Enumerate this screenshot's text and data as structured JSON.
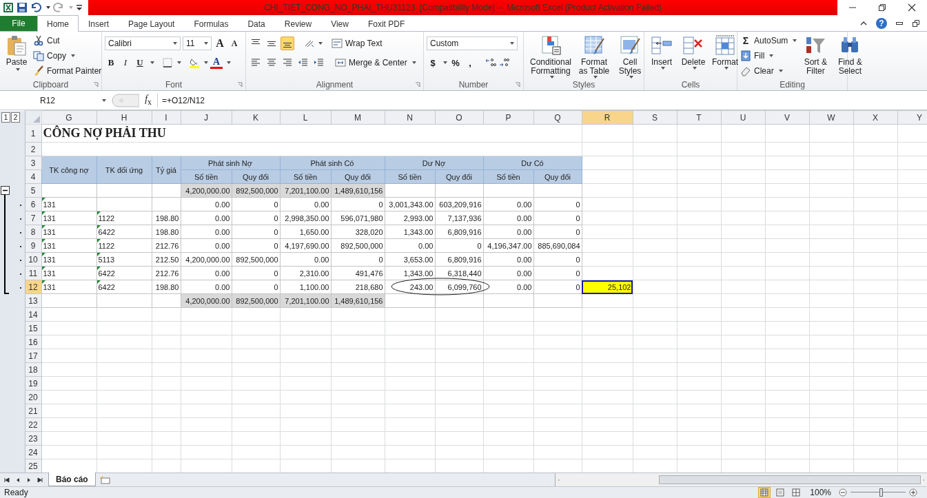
{
  "title_bar": {
    "title": "CHI_TIET_CONG_NO_PHAI_THU31123  [Compatibility Mode]  -  Microsoft Excel (Product Activation Failed)"
  },
  "ribbon": {
    "tabs": [
      {
        "label": "File",
        "kind": "file",
        "selected": false
      },
      {
        "label": "Home",
        "kind": "tab",
        "selected": true
      },
      {
        "label": "Insert",
        "kind": "tab",
        "selected": false
      },
      {
        "label": "Page Layout",
        "kind": "tab",
        "selected": false
      },
      {
        "label": "Formulas",
        "kind": "tab",
        "selected": false
      },
      {
        "label": "Data",
        "kind": "tab",
        "selected": false
      },
      {
        "label": "Review",
        "kind": "tab",
        "selected": false
      },
      {
        "label": "View",
        "kind": "tab",
        "selected": false
      },
      {
        "label": "Foxit PDF",
        "kind": "tab",
        "selected": false
      }
    ],
    "help": "?",
    "clipboard": {
      "label": "Clipboard",
      "paste": "Paste",
      "cut": "Cut",
      "copy": "Copy",
      "format_painter": "Format Painter"
    },
    "font": {
      "label": "Font",
      "family": "Calibri",
      "size": "11",
      "grow": "A",
      "shrink": "A",
      "bold": "B",
      "italic": "I",
      "underline": "U",
      "font_color_letter": "A"
    },
    "alignment": {
      "label": "Alignment",
      "vertical": [
        {
          "kind": "top",
          "selected": false
        },
        {
          "kind": "middle",
          "selected": false
        },
        {
          "kind": "bottom",
          "selected": true
        }
      ],
      "wrap": "Wrap Text",
      "merge": "Merge & Center"
    },
    "number": {
      "label": "Number",
      "format": "Custom",
      "currency": "$",
      "percent": "%",
      "comma": ","
    },
    "styles": {
      "label": "Styles",
      "buttons": [
        {
          "label": "Conditional Formatting",
          "kind": "conditional"
        },
        {
          "label": "Format as Table",
          "kind": "table"
        },
        {
          "label": "Cell Styles",
          "kind": "cellstyles"
        }
      ]
    },
    "cells": {
      "label": "Cells",
      "buttons": [
        {
          "label": "Insert",
          "kind": "insert"
        },
        {
          "label": "Delete",
          "kind": "delete"
        },
        {
          "label": "Format",
          "kind": "format"
        }
      ]
    },
    "editing": {
      "label": "Editing",
      "sigma": "Σ",
      "autosum": "AutoSum",
      "fill": "Fill",
      "clear": "Clear",
      "sort": "Sort & Filter",
      "find": "Find & Select"
    }
  },
  "formula_bar": {
    "name_box": "R12",
    "function_label": "*f*$_{x}$",
    "formula": "=+O12/N12"
  },
  "sheet": {
    "outline_levels": [
      "1",
      "2"
    ],
    "columns": [
      {
        "label": "G",
        "selected": false
      },
      {
        "label": "H",
        "selected": false
      },
      {
        "label": "I",
        "selected": false
      },
      {
        "label": "J",
        "selected": false
      },
      {
        "label": "K",
        "selected": false
      },
      {
        "label": "L",
        "selected": false
      },
      {
        "label": "M",
        "selected": false
      },
      {
        "label": "N",
        "selected": false
      },
      {
        "label": "O",
        "selected": false
      },
      {
        "label": "P",
        "selected": false
      },
      {
        "label": "Q",
        "selected": false
      },
      {
        "label": "R",
        "selected": true
      },
      {
        "label": "S",
        "selected": false
      },
      {
        "label": "T",
        "selected": false
      },
      {
        "label": "U",
        "selected": false
      },
      {
        "label": "V",
        "selected": false
      },
      {
        "label": "W",
        "selected": false
      },
      {
        "label": "X",
        "selected": false
      },
      {
        "label": "Y",
        "selected": false
      }
    ],
    "header": {
      "account": "TK công nợ",
      "contra": "TK đối ứng",
      "rate": "Tỷ giá",
      "groups": [
        {
          "label": "Phát sinh Nợ",
          "sub": [
            "Số tiền",
            "Quy đổi"
          ]
        },
        {
          "label": "Phát sinh Có",
          "sub": [
            "Số tiền",
            "Quy đổi"
          ]
        },
        {
          "label": "Dư Nợ",
          "sub": [
            "Số tiền",
            "Quy đổi"
          ]
        },
        {
          "label": "Dư Có",
          "sub": [
            "Số tiền",
            "Quy đổi"
          ]
        }
      ]
    },
    "rows": [
      {
        "label": "1",
        "selected": false,
        "kind": "title",
        "text": "CÔNG NỢ PHẢI THU"
      },
      {
        "label": "2",
        "selected": false,
        "kind": "blank"
      },
      {
        "label": "3",
        "selected": false,
        "kind": "header_top"
      },
      {
        "label": "4",
        "selected": false,
        "kind": "header_bottom"
      },
      {
        "label": "5",
        "selected": false,
        "kind": "total",
        "collapsible": true,
        "values": [
          "4,200,000.00",
          "892,500,000",
          "7,201,100.00",
          "1,489,610,156"
        ]
      },
      {
        "label": "6",
        "selected": false,
        "kind": "data",
        "grouped": true,
        "flagged": true,
        "account": "131",
        "values": [
          "0.00",
          "0",
          "0.00",
          "0",
          "3,001,343.00",
          "603,209,916",
          "0.00",
          "0"
        ]
      },
      {
        "label": "7",
        "selected": false,
        "kind": "data",
        "grouped": true,
        "flagged": true,
        "account": "131",
        "contra": "1122",
        "rate": "198.80",
        "values": [
          "0.00",
          "0",
          "2,998,350.00",
          "596,071,980",
          "2,993.00",
          "7,137,936",
          "0.00",
          "0"
        ]
      },
      {
        "label": "8",
        "selected": false,
        "kind": "data",
        "grouped": true,
        "flagged": true,
        "account": "131",
        "contra": "6422",
        "rate": "198.80",
        "values": [
          "0.00",
          "0",
          "1,650.00",
          "328,020",
          "1,343.00",
          "6,809,916",
          "0.00",
          "0"
        ]
      },
      {
        "label": "9",
        "selected": false,
        "kind": "data",
        "grouped": true,
        "flagged": true,
        "account": "131",
        "contra": "1122",
        "rate": "212.76",
        "values": [
          "0.00",
          "0",
          "4,197,690.00",
          "892,500,000",
          "0.00",
          "0",
          "4,196,347.00",
          "885,690,084"
        ]
      },
      {
        "label": "10",
        "selected": false,
        "kind": "data",
        "grouped": true,
        "flagged": true,
        "account": "131",
        "contra": "5113",
        "rate": "212.50",
        "values": [
          "4,200,000.00",
          "892,500,000",
          "0.00",
          "0",
          "3,653.00",
          "6,809,916",
          "0.00",
          "0"
        ]
      },
      {
        "label": "11",
        "selected": false,
        "kind": "data",
        "grouped": true,
        "flagged": true,
        "account": "131",
        "contra": "6422",
        "rate": "212.76",
        "values": [
          "0.00",
          "0",
          "2,310.00",
          "491,476",
          "1,343.00",
          "6,318,440",
          "0.00",
          "0"
        ]
      },
      {
        "label": "12",
        "selected": true,
        "kind": "data",
        "grouped": true,
        "flagged": true,
        "account": "131",
        "contra": "6422",
        "rate": "198.80",
        "values": [
          "0.00",
          "0",
          "1,100.00",
          "218,680",
          "243.00",
          "6,099,760",
          "0.00",
          "0"
        ],
        "result": {
          "value": "25,102",
          "selected": true
        }
      },
      {
        "label": "13",
        "selected": false,
        "kind": "total",
        "values": [
          "4,200,000.00",
          "892,500,000",
          "7,201,100.00",
          "1,489,610,156"
        ]
      },
      {
        "label": "14",
        "selected": false,
        "kind": "blank"
      },
      {
        "label": "15",
        "selected": false,
        "kind": "blank"
      },
      {
        "label": "16",
        "selected": false,
        "kind": "blank"
      },
      {
        "label": "17",
        "selected": false,
        "kind": "blank"
      },
      {
        "label": "18",
        "selected": false,
        "kind": "blank"
      },
      {
        "label": "19",
        "selected": false,
        "kind": "blank"
      },
      {
        "label": "20",
        "selected": false,
        "kind": "blank"
      },
      {
        "label": "21",
        "selected": false,
        "kind": "blank"
      },
      {
        "label": "22",
        "selected": false,
        "kind": "blank"
      },
      {
        "label": "23",
        "selected": false,
        "kind": "blank"
      },
      {
        "label": "24",
        "selected": false,
        "kind": "blank"
      },
      {
        "label": "25",
        "selected": false,
        "kind": "blank"
      }
    ]
  },
  "sheet_tabs": [
    {
      "label": "Báo cáo",
      "selected": true
    }
  ],
  "status_bar": {
    "status": "Ready",
    "views": [
      {
        "kind": "normal",
        "selected": true
      },
      {
        "kind": "page_layout",
        "selected": false
      },
      {
        "kind": "page_break",
        "selected": false
      }
    ],
    "zoom": "100%",
    "zoom_slider": {
      "level": 0.55
    }
  }
}
